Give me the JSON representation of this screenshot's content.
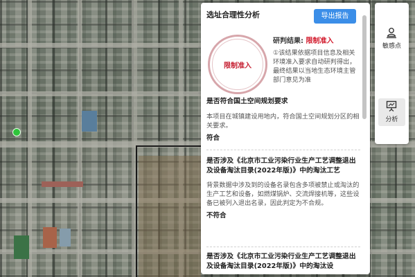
{
  "panel": {
    "title": "选址合理性分析",
    "export_label": "导出报告",
    "seal_text": "限制准入",
    "verdict_label": "研判结果:",
    "verdict_value": "限制准入",
    "verdict_note": "①该结果依据项目信息及相关环境准入要求自动研判得出，最终结果以当地生态环境主管部门意见为准",
    "sections": [
      {
        "title": "是否符合国土空间规划要求",
        "desc": "本项目在城镇建设用地内，符合国土空间规划分区的相关要求。",
        "result": "符合"
      },
      {
        "title": "是否涉及《北京市工业污染行业生产工艺调整退出及设备淘汰目录(2022年版)》中的淘汰工艺",
        "desc": "背景数据中涉及到的设备名录包含多项被禁止或淘汰的生产工艺和设备，如燃煤锅炉、交流焊接机等，这些设备已被列入退出名录，因此判定为不合规。",
        "result": "不符合"
      },
      {
        "title": "是否涉及《北京市工业污染行业生产工艺调整退出及设备淘汰目录(2022年版)》中的淘汰设"
      }
    ]
  },
  "toolbar": {
    "items": [
      {
        "label": "敏感点",
        "icon": "location-person-icon"
      },
      {
        "label": "分析",
        "icon": "presentation-board-icon"
      }
    ]
  },
  "map": {
    "marker_color": "#2fc43b"
  }
}
